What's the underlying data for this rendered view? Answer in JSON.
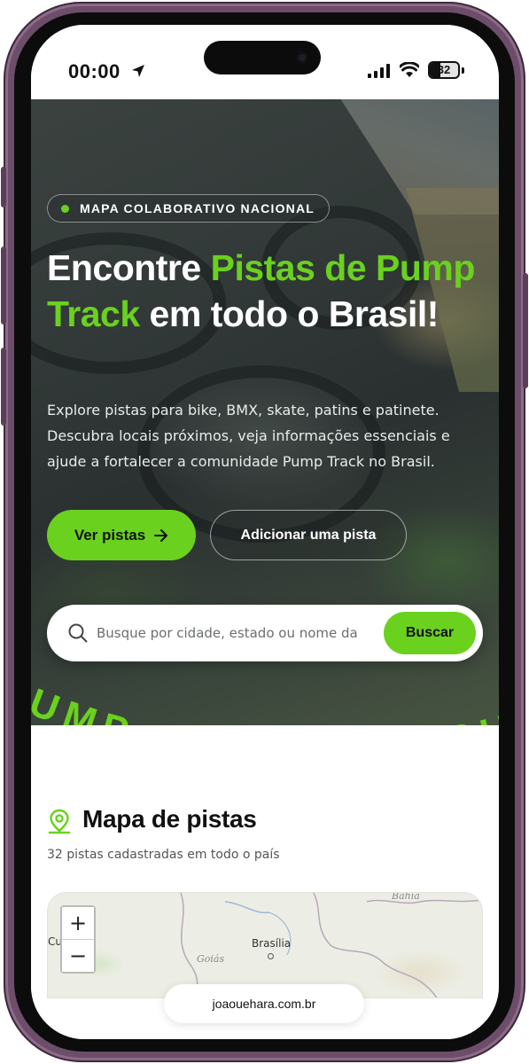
{
  "status_bar": {
    "time": "00:00",
    "battery": "32"
  },
  "hero": {
    "badge": "MAPA COLABORATIVO NACIONAL",
    "title_part1": "Encontre ",
    "title_accent": "Pistas de Pump Track",
    "title_part2": " em todo o Brasil!",
    "description": "Explore pistas para bike, BMX, skate, patins e patinete. Descubra locais próximos, veja informações essenciais e ajude a fortalecer a comunidade Pump Track no Brasil.",
    "primary_button": "Ver pistas",
    "secondary_button": "Adicionar uma pista",
    "search_placeholder": "Busque por cidade, estado ou nome da pista",
    "search_button": "Buscar",
    "curved_text": "PUMP TRACK BRASIL · PUMP TRACK BRASIL"
  },
  "map_section": {
    "title": "Mapa de pistas",
    "subtitle": "32 pistas cadastradas em todo o país",
    "zoom_in": "+",
    "zoom_out": "−",
    "labels": {
      "brasilia": "Brasília",
      "goias": "Goiás",
      "bahia": "Bahia",
      "cu": "Cu"
    }
  },
  "browser": {
    "url": "joaouehara.com.br"
  },
  "colors": {
    "accent": "#6ad11f",
    "frame": "#6d4e6a"
  },
  "icons": [
    "location-arrow-icon",
    "signal-icon",
    "wifi-icon",
    "battery-icon",
    "arrow-right-icon",
    "search-icon",
    "map-pin-icon"
  ]
}
